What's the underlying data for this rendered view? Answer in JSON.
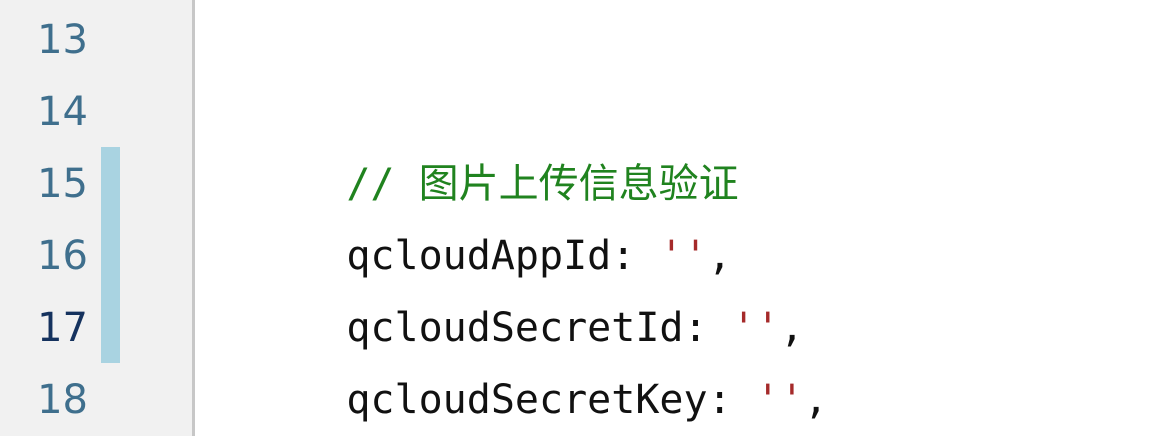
{
  "editor": {
    "lines": [
      {
        "number": "13",
        "code": ""
      },
      {
        "number": "14",
        "comment": "// 图片上传信息验证"
      },
      {
        "number": "15",
        "key": "qcloudAppId",
        "colon": ":",
        "space": " ",
        "value": "''",
        "comma": ","
      },
      {
        "number": "16",
        "key": "qcloudSecretId",
        "colon": ":",
        "space": " ",
        "value": "''",
        "comma": ","
      },
      {
        "number": "17",
        "key": "qcloudSecretKey",
        "colon": ":",
        "space": " ",
        "value": "''",
        "comma": ","
      },
      {
        "number": "18",
        "code": ""
      }
    ]
  }
}
